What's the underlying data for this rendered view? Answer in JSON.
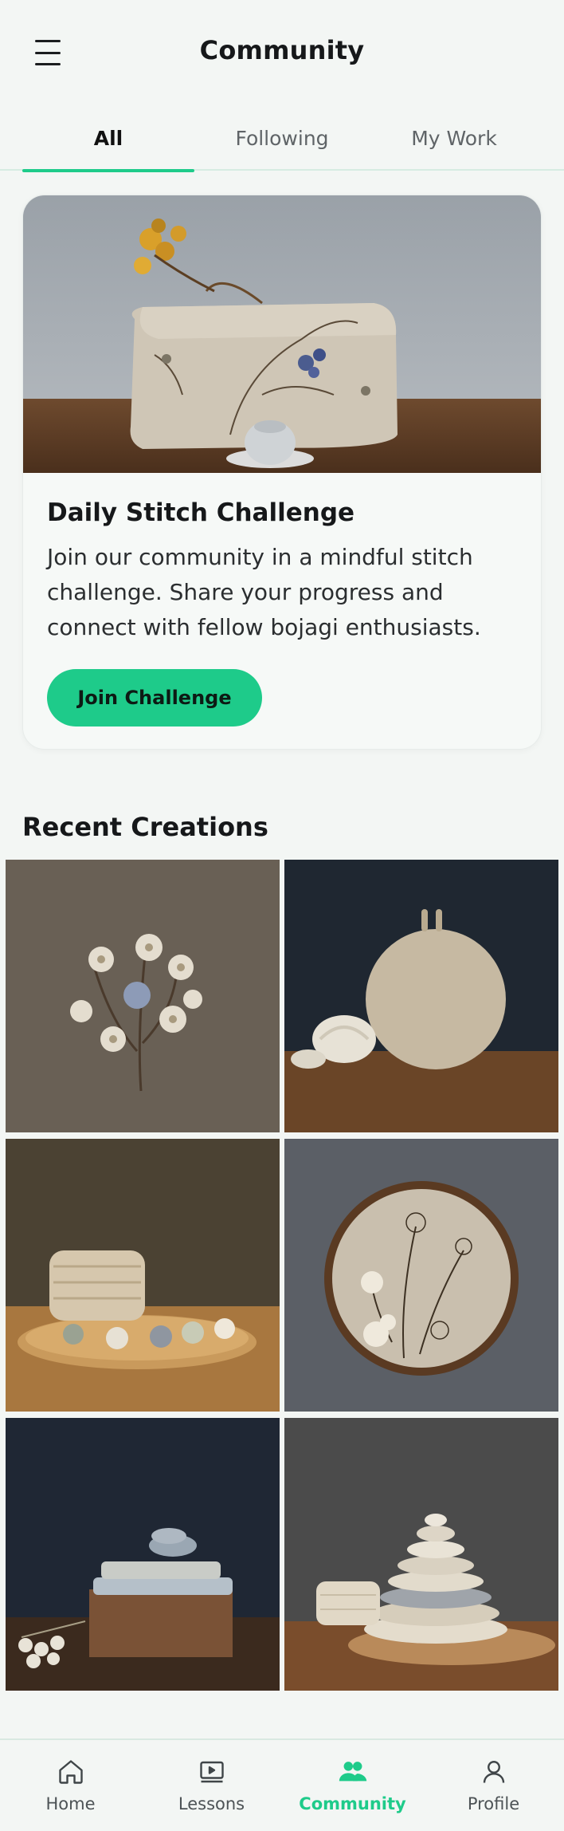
{
  "header": {
    "title": "Community",
    "menu_icon": "hamburger-menu-icon"
  },
  "tabs": [
    {
      "label": "All",
      "active": true
    },
    {
      "label": "Following",
      "active": false
    },
    {
      "label": "My Work",
      "active": false
    }
  ],
  "challenge": {
    "title": "Daily Stitch Challenge",
    "description": "Join our community in a mindful stitch challenge. Share your progress and connect with fellow bojagi enthusiasts.",
    "button_label": "Join Challenge"
  },
  "recent": {
    "title": "Recent Creations"
  },
  "nav": [
    {
      "label": "Home",
      "icon": "home-icon",
      "active": false
    },
    {
      "label": "Lessons",
      "icon": "lessons-icon",
      "active": false
    },
    {
      "label": "Community",
      "icon": "community-icon",
      "active": true
    },
    {
      "label": "Profile",
      "icon": "profile-icon",
      "active": false
    }
  ],
  "colors": {
    "accent": "#1ecb8a",
    "background": "#f3f6f4",
    "text": "#16181a"
  }
}
